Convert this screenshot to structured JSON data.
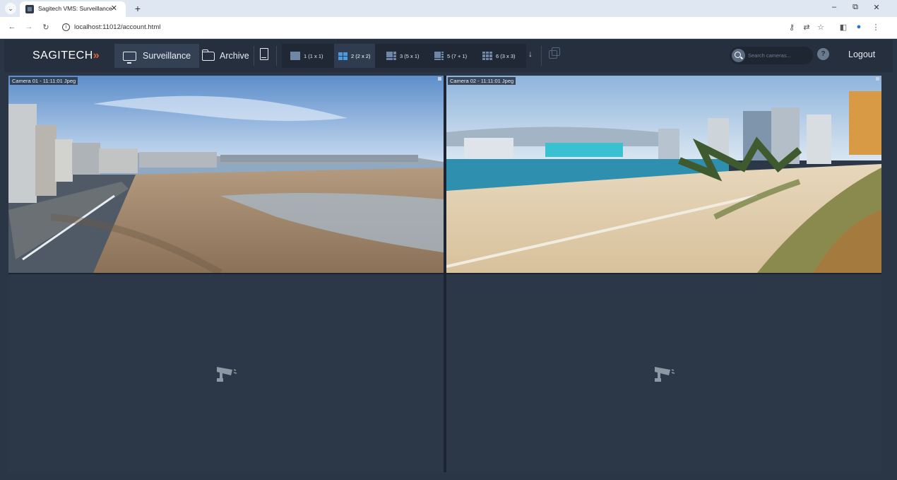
{
  "browser": {
    "tab_title": "Sagitech VMS: Surveillance",
    "tab_close": "✕",
    "new_tab": "+",
    "url": "localhost:11012/account.html"
  },
  "header": {
    "brand": "SAGITECH",
    "brand_mark": "»",
    "nav": {
      "surveillance": "Surveillance",
      "archive": "Archive"
    },
    "layouts": [
      {
        "label": "1 (1 x 1)"
      },
      {
        "label": "2 (2 x 2)",
        "active": true
      },
      {
        "label": "3 (5 x 1)"
      },
      {
        "label": "5 (7 + 1)"
      },
      {
        "label": "6 (3 x 3)"
      }
    ],
    "download_glyph": "↓",
    "search_placeholder": "Search cameras...",
    "help_glyph": "?",
    "logout": "Logout"
  },
  "cameras": [
    {
      "label": "Camera 01 - 11:11:01 Jpeg",
      "has_feed": true
    },
    {
      "label": "Camera 02 - 11:11:01 Jpeg",
      "has_feed": true
    },
    {
      "label": "",
      "has_feed": false
    },
    {
      "label": "",
      "has_feed": false
    }
  ],
  "colors": {
    "app_bg": "#2a3545",
    "header_bg": "#252f3d",
    "brand_accent": "#e2613a",
    "active_layout": "#4a9be0"
  }
}
